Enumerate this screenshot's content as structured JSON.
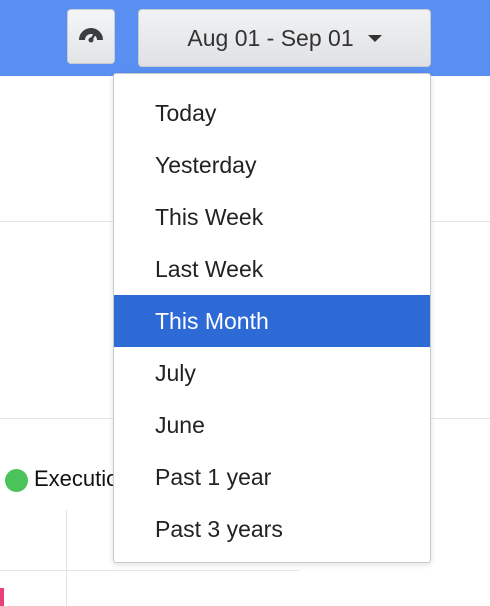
{
  "header": {
    "date_range_label": "Aug 01 - Sep 01",
    "dashboard_icon": "gauge-icon",
    "caret_icon": "caret-down-icon"
  },
  "colors": {
    "header_bg": "#5a8ff2",
    "selected_bg": "#2d6ad6",
    "legend_execution": "#4cc35a",
    "series_pink": "#e8407a"
  },
  "dropdown": {
    "options": [
      {
        "label": "Today",
        "selected": false
      },
      {
        "label": "Yesterday",
        "selected": false
      },
      {
        "label": "This Week",
        "selected": false
      },
      {
        "label": "Last Week",
        "selected": false
      },
      {
        "label": "This Month",
        "selected": true
      },
      {
        "label": "July",
        "selected": false
      },
      {
        "label": "June",
        "selected": false
      },
      {
        "label": "Past 1 year",
        "selected": false
      },
      {
        "label": "Past 3 years",
        "selected": false
      }
    ]
  },
  "chart": {
    "legend_label": "Execution"
  }
}
